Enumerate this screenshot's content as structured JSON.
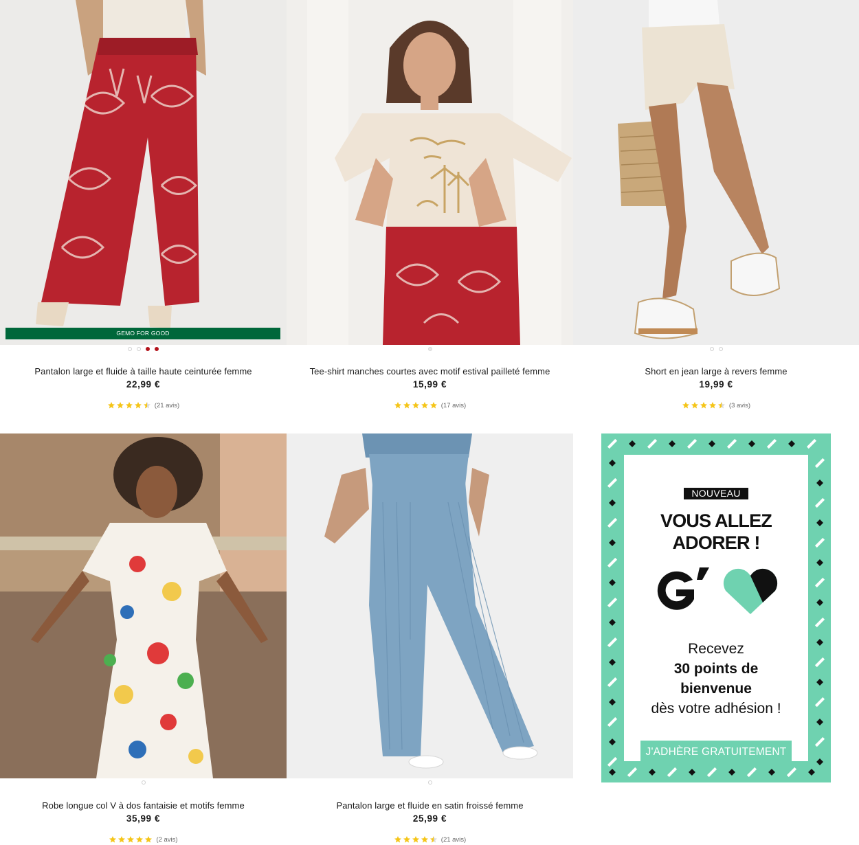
{
  "products": [
    {
      "title": "Pantalon large et fluide à taille haute ceinturée femme",
      "price": "22,99 €",
      "reviews": "(21 avis)",
      "rating": 4.5,
      "badge": "GEMO FOR GOOD",
      "swatches": [
        "white",
        "white",
        "red",
        "red"
      ]
    },
    {
      "title": "Tee-shirt manches courtes avec motif estival pailleté femme",
      "price": "15,99 €",
      "reviews": "(17 avis)",
      "rating": 5,
      "swatches": [
        "grey"
      ]
    },
    {
      "title": "Short en jean large à revers femme",
      "price": "19,99 €",
      "reviews": "(3 avis)",
      "rating": 4.5,
      "swatches": [
        "white",
        "white"
      ]
    },
    {
      "title": "Robe longue col V à dos fantaisie et motifs femme",
      "price": "35,99 €",
      "reviews": "(2 avis)",
      "rating": 5,
      "swatches": [
        "white"
      ]
    },
    {
      "title": "Pantalon large et fluide en satin froissé femme",
      "price": "25,99 €",
      "reviews": "(21 avis)",
      "rating": 4.5,
      "swatches": [
        "white"
      ]
    }
  ],
  "promo": {
    "tag": "NOUVEAU",
    "headline_1": "VOUS ALLEZ",
    "headline_2": "ADORER !",
    "body_1": "Recevez",
    "body_2": "30 points de",
    "body_3": "bienvenue",
    "body_4": "dès votre adhésion !",
    "button": "J'ADHÈRE GRATUITEMENT",
    "accent": "#6fd2b0"
  },
  "colors": {
    "star": "#f5c518",
    "badge": "#00673a",
    "swatch_red": "#b3121a"
  }
}
